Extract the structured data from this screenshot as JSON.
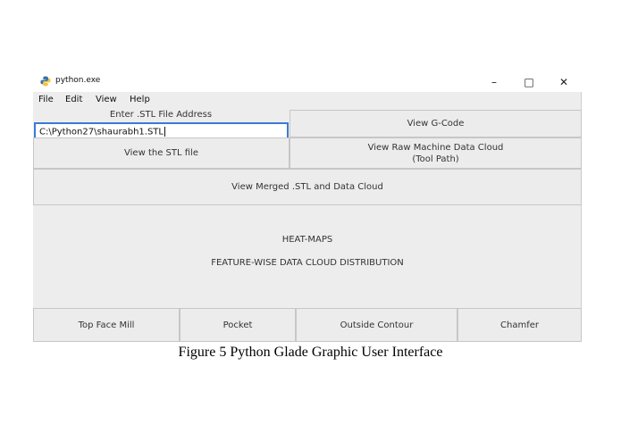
{
  "window": {
    "title": "python.exe",
    "controls": {
      "minimize": "–",
      "maximize": "□",
      "close": "✕"
    }
  },
  "menu": [
    "File",
    "Edit",
    "View",
    "Help"
  ],
  "stl": {
    "label": "Enter .STL File Address",
    "value": "C:\\Python27\\shaurabh1.STL"
  },
  "buttons": {
    "view_gcode": "View G-Code",
    "view_stl": "View the STL file",
    "view_raw_line1": "View Raw Machine Data Cloud",
    "view_raw_line2": "(Tool Path)",
    "view_merged": "View Merged .STL and Data Cloud",
    "top_face_mill": "Top Face Mill",
    "pocket": "Pocket",
    "outside_contour": "Outside Contour",
    "chamfer": "Chamfer"
  },
  "section": {
    "heading": "HEAT-MAPS",
    "subheading": "FEATURE-WISE DATA CLOUD DISTRIBUTION"
  },
  "caption": "Figure 5 Python Glade Graphic User Interface",
  "icons": {
    "app": "python-logo-icon"
  },
  "colors": {
    "focus_border": "#3a7bd5",
    "window_bg": "#ededed"
  }
}
